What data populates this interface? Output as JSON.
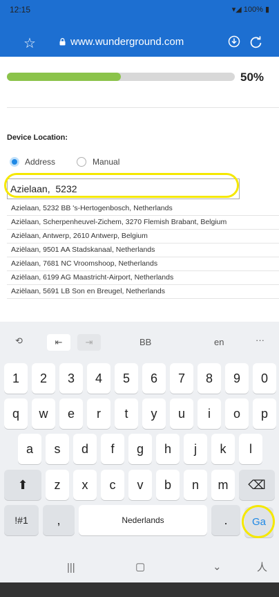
{
  "status_bar": {
    "time": "12:15",
    "battery": "100%"
  },
  "browser": {
    "url": "www.wunderground.com",
    "colors": {
      "chrome": "#1d6fd1"
    }
  },
  "progress": {
    "value": 0.5,
    "label": "50%",
    "colors": {
      "fill": "#8bc34a",
      "track": "#d8d8d8"
    }
  },
  "form": {
    "section_label": "Device Location:",
    "radio_address": "Address",
    "radio_manual": "Manual",
    "address_value": "Azielaan,  5232"
  },
  "suggestions": [
    "Azielaan, 5232 BB 's-Hertogenbosch, Netherlands",
    "Aziëlaan, Scherpenheuvel-Zichem, 3270 Flemish Brabant, Belgium",
    "Aziëlaan, Antwerp, 2610 Antwerp, Belgium",
    "Aziëlaan, 9501 AA Stadskanaal, Netherlands",
    "Aziëlaan, 7681 NC Vroomshoop, Netherlands",
    "Aziëlaan, 6199 AG Maastricht-Airport, Netherlands",
    "Aziëlaan, 5691 LB Son en Breugel, Netherlands"
  ],
  "keyboard": {
    "toolbar": {
      "bb": "BB",
      "lang": "en",
      "more": "···"
    },
    "row1": [
      "1",
      "2",
      "3",
      "4",
      "5",
      "6",
      "7",
      "8",
      "9",
      "0"
    ],
    "row2": [
      "q",
      "w",
      "e",
      "r",
      "t",
      "y",
      "u",
      "i",
      "o",
      "p"
    ],
    "row3": [
      "a",
      "s",
      "d",
      "f",
      "g",
      "h",
      "j",
      "k",
      "l"
    ],
    "row4": [
      "z",
      "x",
      "c",
      "v",
      "b",
      "n",
      "m"
    ],
    "symbols_label": "!#1",
    "comma": ",",
    "space_label": "Nederlands",
    "period": ".",
    "go_label": "Ga",
    "colors": {
      "go_text": "#1e88e5",
      "highlight": "#f5e800"
    }
  }
}
